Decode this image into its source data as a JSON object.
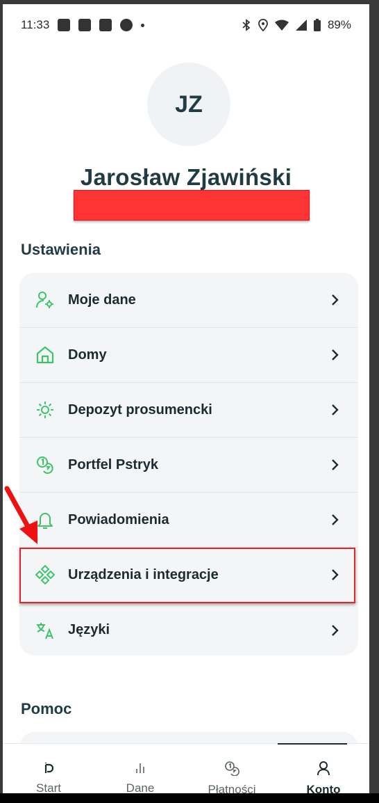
{
  "status_bar": {
    "time": "11:33",
    "battery": "89%"
  },
  "profile": {
    "initials": "JZ",
    "name": "Jarosław Zjawiński"
  },
  "settings": {
    "title": "Ustawienia",
    "items": [
      {
        "label": "Moje dane",
        "icon": "user-settings-icon"
      },
      {
        "label": "Domy",
        "icon": "home-icon"
      },
      {
        "label": "Depozyt prosumencki",
        "icon": "sun-icon"
      },
      {
        "label": "Portfel Pstryk",
        "icon": "coins-icon"
      },
      {
        "label": "Powiadomienia",
        "icon": "bell-icon"
      },
      {
        "label": "Urządzenia i integracje",
        "icon": "devices-icon"
      },
      {
        "label": "Języki",
        "icon": "translate-icon"
      }
    ]
  },
  "help": {
    "title": "Pomoc"
  },
  "bottom_nav": {
    "items": [
      {
        "label": "Start",
        "icon": "start-icon"
      },
      {
        "label": "Dane",
        "icon": "chart-icon"
      },
      {
        "label": "Płatności",
        "icon": "payments-icon"
      },
      {
        "label": "Konto",
        "icon": "account-icon",
        "active": true
      }
    ]
  },
  "colors": {
    "accent_green": "#3cc46a",
    "text_dark": "#1f3c45",
    "highlight_red": "#e0262b"
  }
}
